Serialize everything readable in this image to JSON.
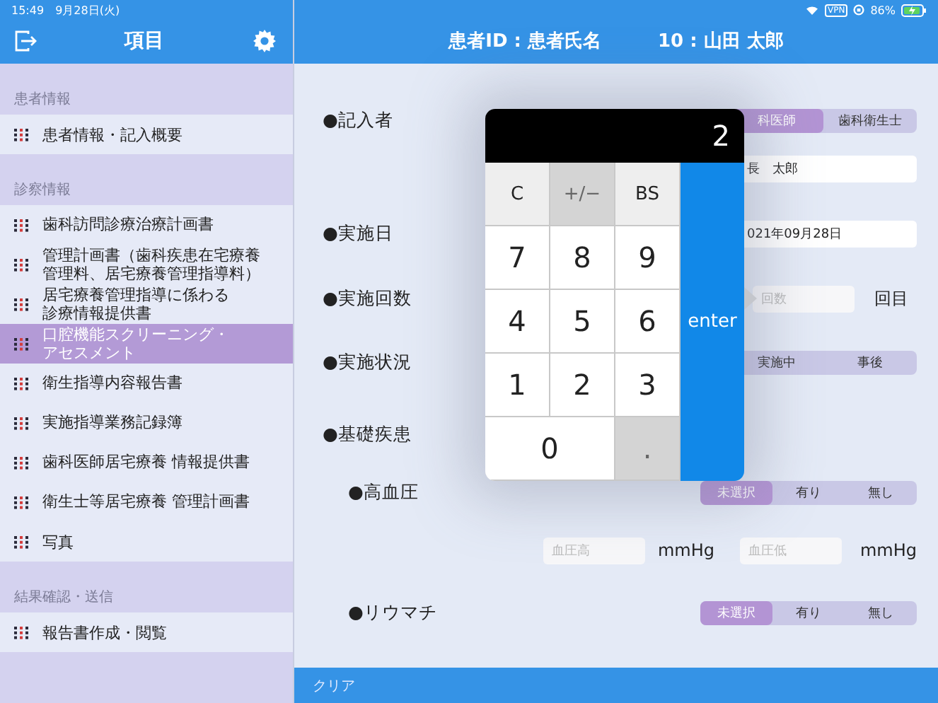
{
  "status_bar": {
    "time": "15:49",
    "date": "9月28日(火)",
    "vpn": "VPN",
    "battery": "86%"
  },
  "sidebar": {
    "title": "項目",
    "sections": [
      {
        "title": "患者情報",
        "items": [
          {
            "lines": [
              "患者情報・記入概要"
            ],
            "selected": false
          }
        ]
      },
      {
        "title": "診察情報",
        "items": [
          {
            "lines": [
              "歯科訪問診療治療計画書"
            ],
            "selected": false
          },
          {
            "lines": [
              "管理計画書（歯科疾患在宅療養",
              "管理料、居宅療養管理指導料）"
            ],
            "selected": false
          },
          {
            "lines": [
              "居宅療養管理指導に係わる",
              "診療情報提供書"
            ],
            "selected": false
          },
          {
            "lines": [
              "口腔機能スクリーニング・",
              "アセスメント"
            ],
            "selected": true
          },
          {
            "lines": [
              "衛生指導内容報告書"
            ],
            "selected": false
          },
          {
            "lines": [
              "実施指導業務記録簿"
            ],
            "selected": false
          },
          {
            "lines": [
              "歯科医師居宅療養 情報提供書"
            ],
            "selected": false
          },
          {
            "lines": [
              "衛生士等居宅療養 管理計画書"
            ],
            "selected": false
          },
          {
            "lines": [
              "写真"
            ],
            "selected": false
          }
        ]
      },
      {
        "title": "結果確認・送信",
        "items": [
          {
            "lines": [
              "報告書作成・閲覧"
            ],
            "selected": false
          }
        ]
      }
    ]
  },
  "header": {
    "patient_label": "患者ID : 患者氏名",
    "patient_value": "10 : 山田 太郎"
  },
  "form": {
    "rows": [
      {
        "kind": "segmented",
        "label": "●記入者",
        "options": [
          {
            "label": "科医師",
            "selected": true
          },
          {
            "label": "歯科衛生士",
            "selected": false
          }
        ]
      },
      {
        "kind": "field",
        "value": "長　太郎"
      },
      {
        "kind": "field",
        "label": "●実施日",
        "value": "021年09月28日"
      },
      {
        "kind": "count",
        "label": "●実施回数",
        "placeholder": "回数",
        "unit": "回目"
      },
      {
        "kind": "segmented",
        "label": "●実施状況",
        "options": [
          {
            "label": "実施中",
            "selected": false
          },
          {
            "label": "事後",
            "selected": false
          }
        ]
      },
      {
        "kind": "heading",
        "label": "●基礎疾患"
      },
      {
        "kind": "subsegmented",
        "label": "●高血圧",
        "options": [
          {
            "label": "未選択",
            "selected": true
          },
          {
            "label": "有り",
            "selected": false
          },
          {
            "label": "無し",
            "selected": false
          }
        ]
      },
      {
        "kind": "pressure",
        "fields": [
          {
            "placeholder": "血圧高",
            "unit": "mmHg"
          },
          {
            "placeholder": "血圧低",
            "unit": "mmHg"
          }
        ]
      },
      {
        "kind": "subsegmented",
        "label": "●リウマチ",
        "options": [
          {
            "label": "未選択",
            "selected": true
          },
          {
            "label": "有り",
            "selected": false
          },
          {
            "label": "無し",
            "selected": false
          }
        ]
      }
    ]
  },
  "keypad": {
    "display": "2",
    "keys": [
      {
        "label": "C",
        "kind": "function",
        "disabled": false
      },
      {
        "label": "+/−",
        "kind": "function",
        "disabled": true
      },
      {
        "label": "BS",
        "kind": "function",
        "disabled": false
      },
      {
        "label": "7",
        "kind": "digit",
        "disabled": false
      },
      {
        "label": "8",
        "kind": "digit",
        "disabled": false
      },
      {
        "label": "9",
        "kind": "digit",
        "disabled": false
      },
      {
        "label": "4",
        "kind": "digit",
        "disabled": false
      },
      {
        "label": "5",
        "kind": "digit",
        "disabled": false
      },
      {
        "label": "6",
        "kind": "digit",
        "disabled": false
      },
      {
        "label": "1",
        "kind": "digit",
        "disabled": false
      },
      {
        "label": "2",
        "kind": "digit",
        "disabled": false
      },
      {
        "label": "3",
        "kind": "digit",
        "disabled": false
      },
      {
        "label": "0",
        "kind": "wide",
        "disabled": false
      },
      {
        "label": ".",
        "kind": "digit",
        "disabled": true
      },
      {
        "label": "enter",
        "kind": "enter",
        "disabled": false
      }
    ]
  },
  "bottom_bar": {
    "clear": "クリア"
  }
}
